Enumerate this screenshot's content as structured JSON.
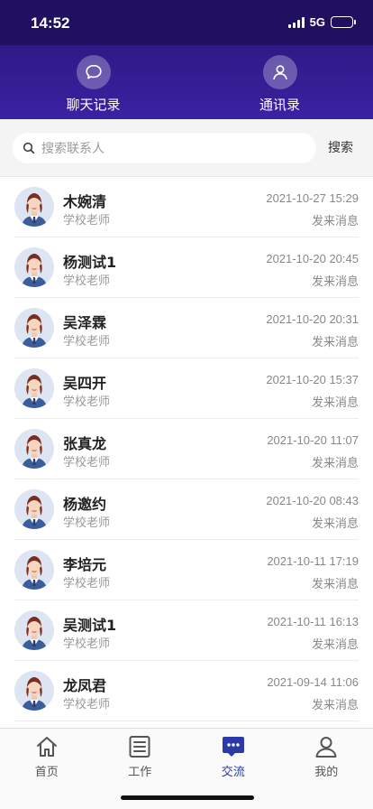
{
  "status_bar": {
    "time": "14:52",
    "network": "5G",
    "battery_level": 0.45,
    "icons": [
      "signal-icon",
      "battery-icon"
    ]
  },
  "header": {
    "tabs": [
      {
        "label": "聊天记录",
        "icon": "chat-bubble-icon"
      },
      {
        "label": "通讯录",
        "icon": "person-icon"
      }
    ],
    "background": "#2d1a86"
  },
  "search": {
    "placeholder": "搜索联系人",
    "button_label": "搜索",
    "icon": "search-icon"
  },
  "contacts": [
    {
      "name": "木婉清",
      "role": "学校老师",
      "time": "2021-10-27 15:29",
      "status": "发来消息"
    },
    {
      "name": "杨测试1",
      "role": "学校老师",
      "time": "2021-10-20 20:45",
      "status": "发来消息"
    },
    {
      "name": "吴泽霖",
      "role": "学校老师",
      "time": "2021-10-20 20:31",
      "status": "发来消息"
    },
    {
      "name": "吴四开",
      "role": "学校老师",
      "time": "2021-10-20 15:37",
      "status": "发来消息"
    },
    {
      "name": "张真龙",
      "role": "学校老师",
      "time": "2021-10-20 11:07",
      "status": "发来消息"
    },
    {
      "name": "杨邀约",
      "role": "学校老师",
      "time": "2021-10-20 08:43",
      "status": "发来消息"
    },
    {
      "name": "李培元",
      "role": "学校老师",
      "time": "2021-10-11 17:19",
      "status": "发来消息"
    },
    {
      "name": "吴测试1",
      "role": "学校老师",
      "time": "2021-10-11 16:13",
      "status": "发来消息"
    },
    {
      "name": "龙凤君",
      "role": "学校老师",
      "time": "2021-09-14 11:06",
      "status": "发来消息"
    }
  ],
  "bottom_nav": {
    "items": [
      {
        "label": "首页",
        "icon": "home-icon",
        "active": false
      },
      {
        "label": "工作",
        "icon": "document-list-icon",
        "active": false
      },
      {
        "label": "交流",
        "icon": "message-icon",
        "active": true
      },
      {
        "label": "我的",
        "icon": "profile-icon",
        "active": false
      }
    ],
    "active_color": "#2b3aa8"
  }
}
